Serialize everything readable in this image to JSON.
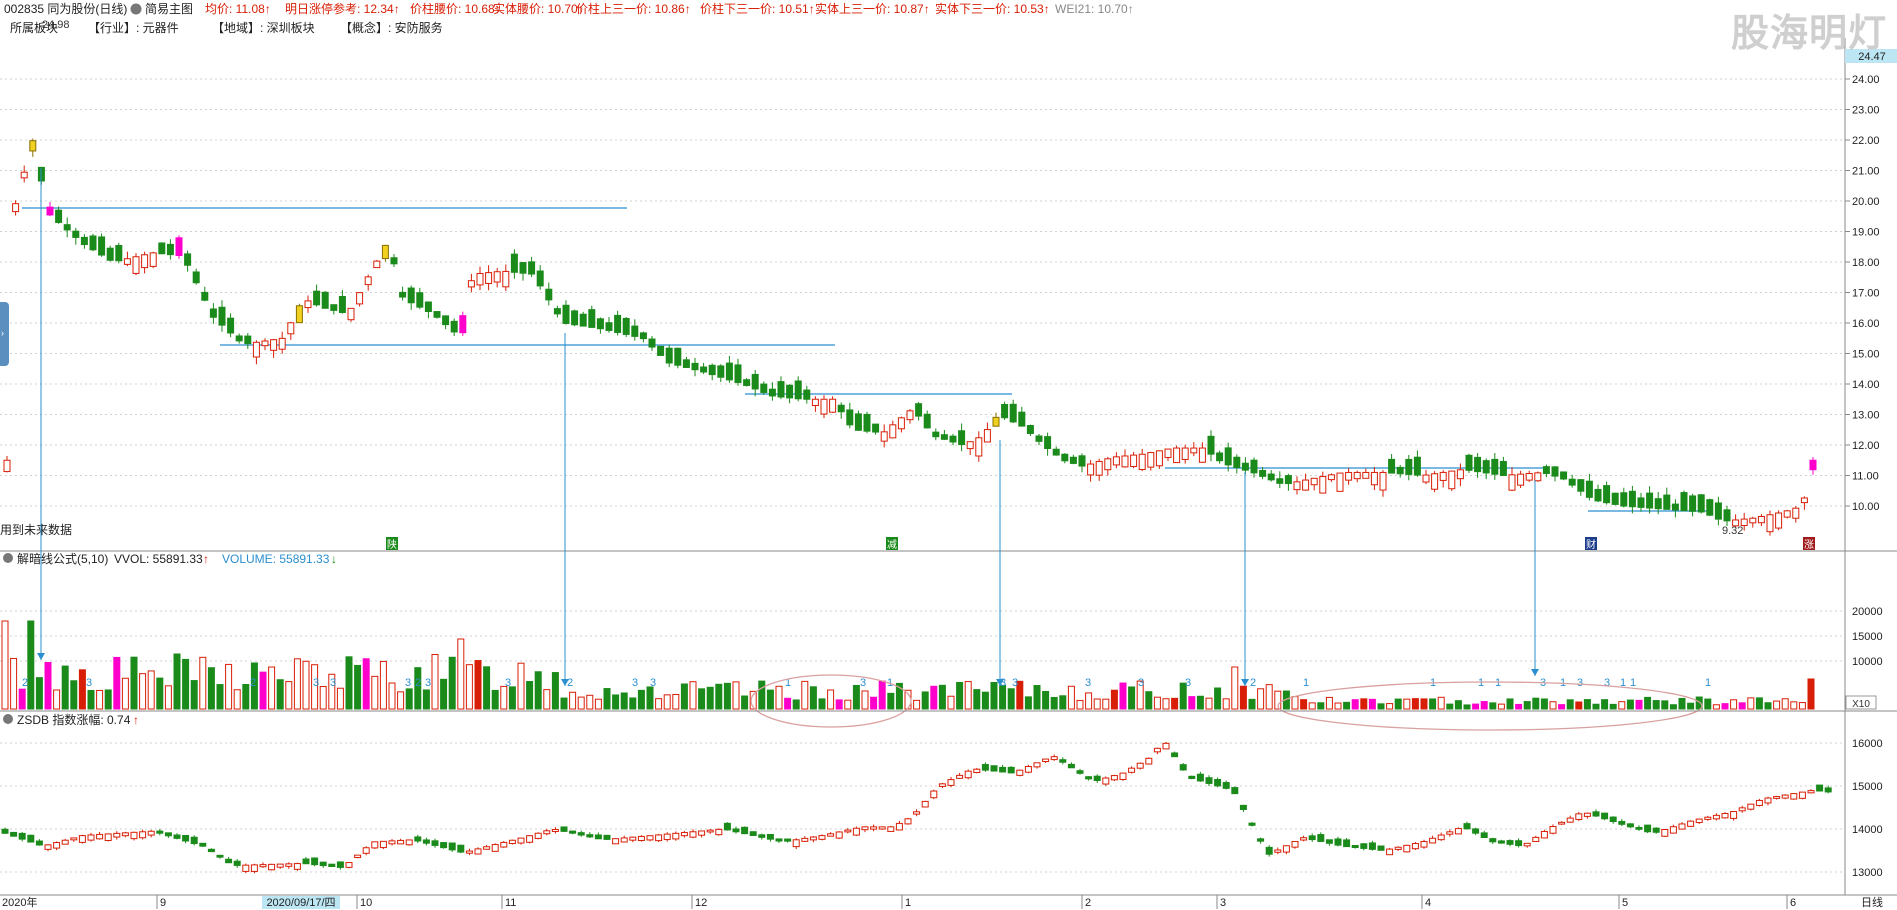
{
  "header": {
    "stock": "002835 同为股份(日线)",
    "template": "简易主图",
    "indicators": [
      {
        "label": "均价:",
        "value": "11.08",
        "arrow": "↑",
        "color": "#d81e06"
      },
      {
        "label": "明日涨停参考:",
        "value": "12.34",
        "arrow": "↑",
        "color": "#d81e06"
      },
      {
        "label": "价柱腰价:",
        "value": "10.68",
        "arrow": "↑",
        "color": "#d81e06"
      },
      {
        "label": "实体腰价:",
        "value": "10.70",
        "arrow": "↑",
        "color": "#d81e06"
      },
      {
        "label": "价柱上三一价:",
        "value": "10.86",
        "arrow": "↑",
        "color": "#d81e06"
      },
      {
        "label": "价柱下三一价:",
        "value": "10.51",
        "arrow": "↑",
        "color": "#d81e06"
      },
      {
        "label": "实体上三一价:",
        "value": "10.87",
        "arrow": "↑",
        "color": "#d81e06"
      },
      {
        "label": "实体下三一价:",
        "value": "10.53",
        "arrow": "↑",
        "color": "#d81e06"
      },
      {
        "label": "WEI21:",
        "value": "10.70",
        "arrow": "↑",
        "color": "#888888"
      }
    ],
    "row2": {
      "board": "所属板块",
      "high_label": "24.98",
      "industry": "【行业】: 元器件",
      "region": "【地域】: 深圳板块",
      "concept": "【概念】: 安防服务"
    },
    "watermark": "股海明灯"
  },
  "main_panel": {
    "future_data_note": "用到未来数据",
    "price_axis": [
      "24.00",
      "23.00",
      "22.00",
      "21.00",
      "20.00",
      "19.00",
      "18.00",
      "17.00",
      "16.00",
      "15.00",
      "14.00",
      "13.00",
      "12.00",
      "11.00",
      "10.00"
    ],
    "current_price_tag": "24.47",
    "low_label": "9.32",
    "event_markers": [
      "陕",
      "减",
      "财",
      "涨"
    ]
  },
  "volume_panel": {
    "title": "解暗线公式(5,10)",
    "vvol_label": "VVOL: 55891.33",
    "vvol_arrow": "↑",
    "volume_label": "VOLUME: 55891.33",
    "volume_arrow": "↓",
    "axis": [
      "20000",
      "15000",
      "10000"
    ],
    "multiplier": "X10"
  },
  "index_panel": {
    "title": "ZSDB 指数涨幅: 0.74",
    "arrow": "↑",
    "axis": [
      "16000",
      "15000",
      "14000",
      "13000"
    ]
  },
  "time_axis": {
    "labels": [
      "2020年",
      "9",
      "10",
      "11",
      "12",
      "1",
      "2",
      "3",
      "4",
      "5",
      "6"
    ],
    "cursor_label": "2020/09/17/四",
    "period": "日线"
  },
  "colors": {
    "up": "#d81e06",
    "down": "#1a8a1a",
    "pink": "#ff00cc",
    "yellow": "#f0d020",
    "line": "#2b8fcf",
    "grid": "#d0d0d0",
    "ellipse": "#d9a0a0"
  }
}
